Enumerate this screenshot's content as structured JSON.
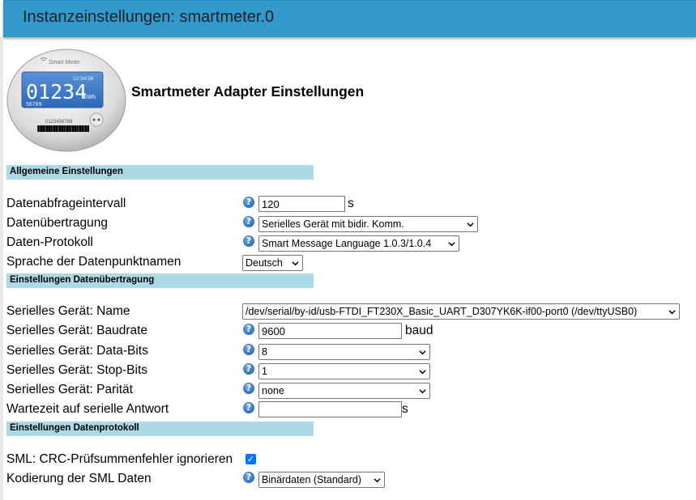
{
  "window": {
    "title": "Instanzeinstellungen: smartmeter.0"
  },
  "meter_image": {
    "brand": "Smart Meter",
    "time": "12:34:56",
    "reading": "01234",
    "unit": "kWh",
    "sub_reading": "56789",
    "serial": "0123456789"
  },
  "adapter_heading": "Smartmeter Adapter Einstellungen",
  "sections": {
    "general": "Allgemeine Einstellungen",
    "transport": "Einstellungen Datenübertragung",
    "protocol": "Einstellungen Datenprotokoll"
  },
  "general": {
    "interval_label": "Datenabfrageintervall",
    "interval_value": "120",
    "interval_unit": "s",
    "transport_label": "Datenübertragung",
    "transport_value": "Serielles Gerät mit bidir. Komm.",
    "protocol_label": "Daten-Protokoll",
    "protocol_value": "Smart Message Language 1.0.3/1.0.4",
    "language_label": "Sprache der Datenpunktnamen",
    "language_value": "Deutsch"
  },
  "serial": {
    "name_label": "Serielles Gerät: Name",
    "name_value": "/dev/serial/by-id/usb-FTDI_FT230X_Basic_UART_D307YK6K-if00-port0 (/dev/ttyUSB0)",
    "baud_label": "Serielles Gerät: Baudrate",
    "baud_value": "9600",
    "baud_unit": "baud",
    "databits_label": "Serielles Gerät: Data-Bits",
    "databits_value": "8",
    "stopbits_label": "Serielles Gerät: Stop-Bits",
    "stopbits_value": "1",
    "parity_label": "Serielles Gerät: Parität",
    "parity_value": "none",
    "wait_label": "Wartezeit auf serielle Antwort",
    "wait_value": "",
    "wait_unit": "s"
  },
  "protocol": {
    "crc_label": "SML: CRC-Prüfsummenfehler ignorieren",
    "crc_checked": true,
    "encoding_label": "Kodierung der SML Daten",
    "encoding_value": "Binärdaten (Standard)"
  },
  "help_glyph": "?",
  "colors": {
    "titlebar": "#3399cc",
    "section": "#add8e6",
    "help": "#2f6fbd",
    "checkbox": "#0075ff"
  }
}
